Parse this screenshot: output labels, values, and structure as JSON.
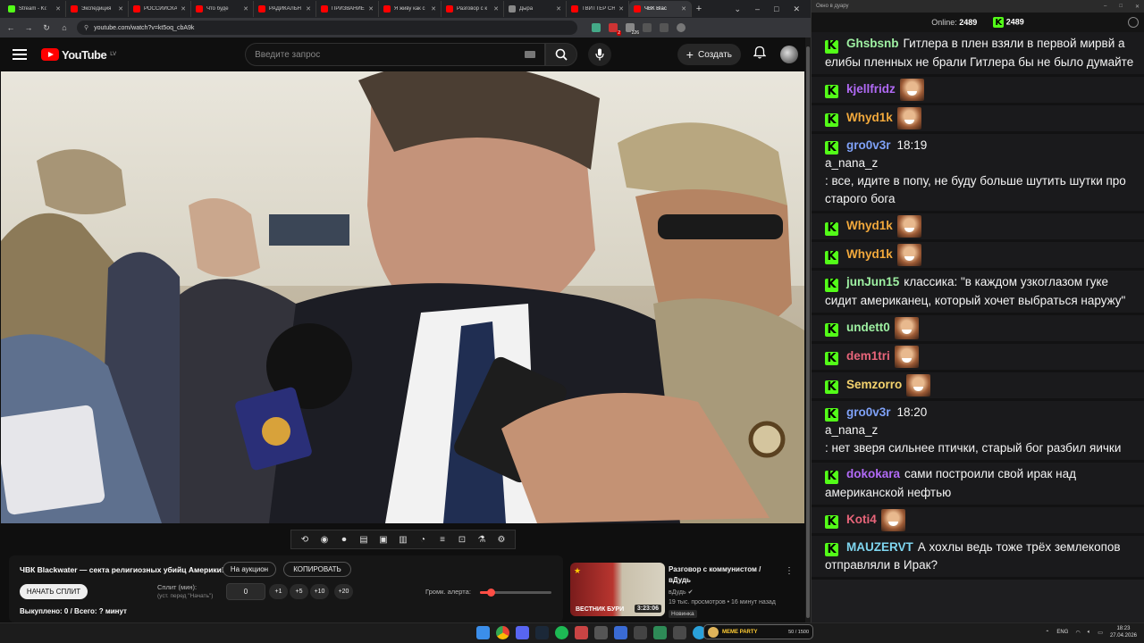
{
  "browser": {
    "tabs": [
      {
        "title": "Stream - Ki:",
        "color": "#53fc18",
        "active": false
      },
      {
        "title": "Экспедиция",
        "color": "#ff0000",
        "active": false
      },
      {
        "title": "РОССИЙСКАЯ",
        "color": "#ff0000",
        "active": false
      },
      {
        "title": "Что буде",
        "color": "#ff0000",
        "active": false
      },
      {
        "title": "РАДИКАЛЬН",
        "color": "#ff0000",
        "active": false
      },
      {
        "title": "ПРИЗВАНИЕ",
        "color": "#ff0000",
        "active": false
      },
      {
        "title": "Я живу как с",
        "color": "#ff0000",
        "active": false
      },
      {
        "title": "Разговор с к",
        "color": "#ff0000",
        "active": false
      },
      {
        "title": "Дыра",
        "color": "#888888",
        "active": false
      },
      {
        "title": "ТВИТТЕР СН",
        "color": "#ff0000",
        "active": false
      },
      {
        "title": "ЧВК Blac",
        "color": "#ff0000",
        "active": true
      }
    ],
    "url": "youtube.com/watch?v=kt5oq_cbA9k",
    "ext_badge_1": "2",
    "ext_badge_2": "226"
  },
  "youtube": {
    "logo_text": "YouTube",
    "region": "LV",
    "search_placeholder": "Введите запрос",
    "create_label": "Создать",
    "video_title": "ЧВК Blackwater — секта религиозных убийц Америки!",
    "auction_button": "На аукцион",
    "copy_button": "КОПИРОВАТЬ",
    "split_start_button": "НАЧАТЬ СПЛИТ",
    "split_label": "Сплит (мин):",
    "split_hint": "(уст. перед \"Начать\")",
    "split_value": "0",
    "increments": [
      "+1",
      "+5",
      "+10",
      "+20"
    ],
    "alert_volume_label": "Громк. алерта:",
    "alert_volume_fraction": 0.15,
    "bought_text": "Выкуплено: 0 / Всего: ? минут"
  },
  "recommendation": {
    "title": "Разговор с коммунистом / вДудь",
    "channel": "вДудь",
    "meta": "19 тыс. просмотров • 16 минут назад",
    "badge": "Новинка",
    "thumb_caption": "ВЕСТНИК БУРИ",
    "duration": "3:23:06"
  },
  "chat": {
    "window_title": "Окно в дуару",
    "online_label": "Online:",
    "online_count": "2489",
    "kick_count": "2489",
    "colors": {
      "accent": "#53fc18"
    },
    "messages": [
      {
        "user": "Ghsbsnb",
        "color": "#9ef0a2",
        "text": "Гитлера в плен взяли в первой мирвй а елибы пленных не брали Гитлера бы не было думайте",
        "time": "",
        "emote": false
      },
      {
        "user": "kjellfridz",
        "color": "#b16af6",
        "text": "",
        "time": "",
        "emote": true
      },
      {
        "user": "Whyd1k",
        "color": "#f2a93c",
        "text": "",
        "time": "",
        "emote": true
      },
      {
        "user": "gro0v3r",
        "color": "#7fa1f7",
        "text": "a_nana_z\n: все, идите в попу, не буду больше шутить шутки про старого бога",
        "time": "18:19",
        "emote": false
      },
      {
        "user": "Whyd1k",
        "color": "#f2a93c",
        "text": "",
        "time": "",
        "emote": true
      },
      {
        "user": "Whyd1k",
        "color": "#f2a93c",
        "text": "",
        "time": "",
        "emote": true
      },
      {
        "user": "junJun15",
        "color": "#9ef0a2",
        "text": "классика: \"в каждом узкоглазом гуке сидит американец, который хочет выбраться наружу\"",
        "time": "",
        "emote": false
      },
      {
        "user": "undett0",
        "color": "#9ef0a2",
        "text": "",
        "time": "",
        "emote": true
      },
      {
        "user": "dem1tri",
        "color": "#e8657a",
        "text": "",
        "time": "",
        "emote": true
      },
      {
        "user": "Semzorro",
        "color": "#f5d36e",
        "text": "",
        "time": "",
        "emote": true
      },
      {
        "user": "gro0v3r",
        "color": "#7fa1f7",
        "text": "a_nana_z\n: нет зверя сильнее птички, старый бог разбил яички",
        "time": "18:20",
        "emote": false
      },
      {
        "user": "dokokara",
        "color": "#b16af6",
        "text": "сами построили свой ирак над американской нефтью",
        "time": "",
        "emote": false
      },
      {
        "user": "Koti4",
        "color": "#e8657a",
        "text": "",
        "time": "",
        "emote": true
      },
      {
        "user": "MAUZERVT",
        "color": "#7fd6f0",
        "text": "А хохлы ведь тоже трёх землекопов отправляли в Ирак?",
        "time": "",
        "emote": false
      }
    ]
  },
  "taskbar": {
    "meme_label": "MEME PARTY",
    "meme_count": "50 / 1500",
    "lang": "ENG",
    "time": "18:23",
    "date": "27.04.2026"
  }
}
